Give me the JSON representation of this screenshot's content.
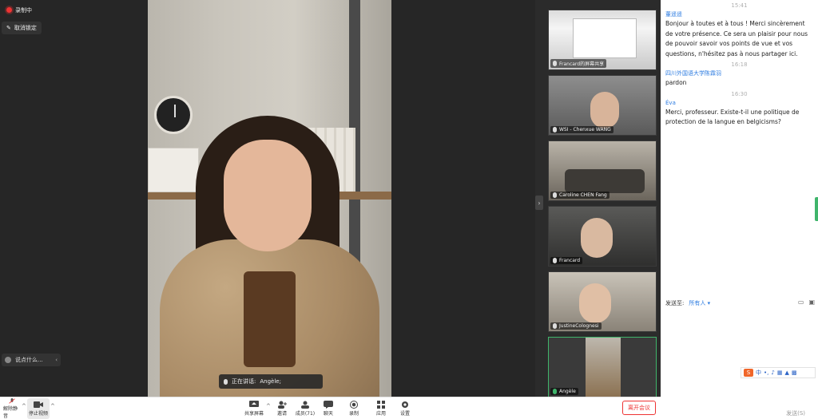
{
  "stage": {
    "recording_label": "录制中",
    "unpin_label": "取消锁定",
    "say_something_label": "说点什么...",
    "speaking_prefix": "正在讲话: ",
    "speaking_name": "Angèle;"
  },
  "participants": [
    {
      "name": "Francard的屏幕共享"
    },
    {
      "name": "WSI - Chenxue WANG"
    },
    {
      "name": "Caroline CHEN Fang"
    },
    {
      "name": "Francard"
    },
    {
      "name": "JustineColognesi"
    },
    {
      "name": "Angèle"
    }
  ],
  "chat": {
    "messages": [
      {
        "time": "15:41",
        "sender": "董遥遥",
        "text": "Bonjour à toutes et à tous ! Merci sincèrement de votre présence. Ce sera un plaisir pour nous de pouvoir savoir vos points de vue et vos questions, n'hésitez pas à nous partager ici."
      },
      {
        "time": "16:18",
        "sender": "四川外国语大学陈霖羽",
        "text": "pardon"
      },
      {
        "time": "16:30",
        "sender": "Éva",
        "text": "Merci, professeur. Existe-t-il une politique de protection de la langue en belgicisms?"
      }
    ],
    "send_to_label": "发送至:",
    "send_to_value": "所有人 ▾",
    "send_button": "发送(S)",
    "ime_label": "中"
  },
  "toolbar": {
    "unmute": "解除静音",
    "stop_video": "停止视频",
    "share_screen": "共享屏幕",
    "invite": "邀请",
    "members": "成员(71)",
    "chat": "聊天",
    "record": "录制",
    "apps": "应用",
    "settings": "设置",
    "leave": "离开会议"
  },
  "colors": {
    "accent_blue": "#2f7de1",
    "leave_red": "#e33333",
    "active_green": "#3fb56b"
  }
}
